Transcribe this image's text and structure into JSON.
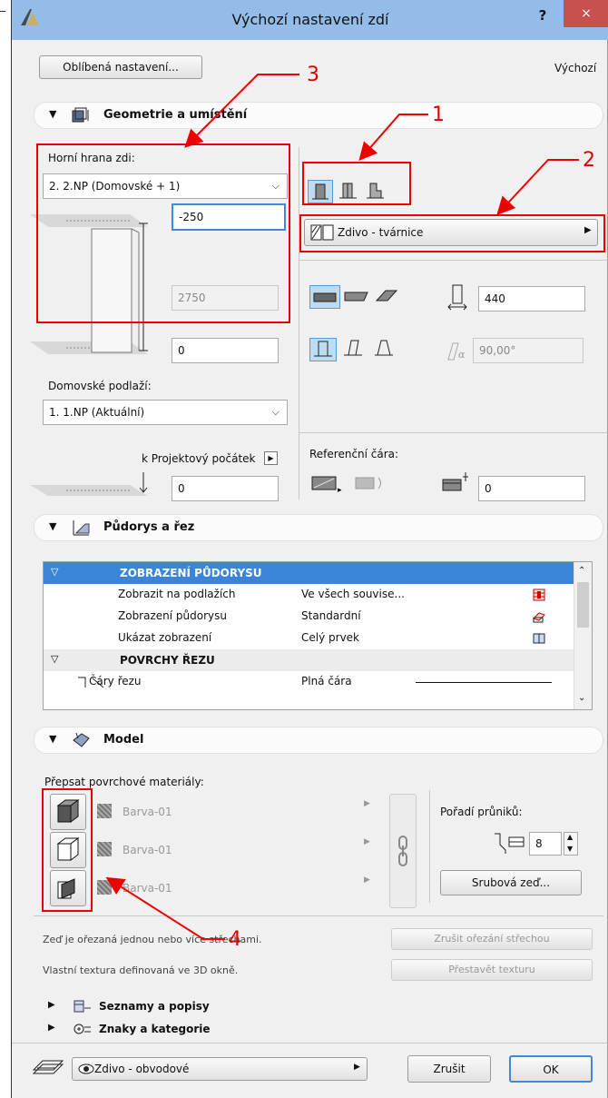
{
  "window": {
    "title": "Výchozí nastavení zdí",
    "help": "?",
    "close": "×"
  },
  "top": {
    "favorites_button": "Oblíbená nastavení...",
    "default_label": "Výchozí"
  },
  "sections": {
    "geometry": "Geometrie a umístění",
    "floorplan": "Půdorys a řez",
    "model": "Model",
    "lists": "Seznamy a popisy",
    "tags": "Znaky a kategorie"
  },
  "geometry": {
    "top_edge_label": "Horní hrana zdi:",
    "top_edge_value": "2. 2.NP (Domovské + 1)",
    "offset_value": "-250",
    "height_value": "2750",
    "bottom_offset": "0",
    "home_story_label": "Domovské podlaží:",
    "home_story_value": "1. 1.NP (Aktuální)",
    "project_origin_label": "k Projektový počátek",
    "project_origin_value": "0",
    "structure_value": "Zdivo - tvárnice",
    "thickness_value": "440",
    "angle_value": "90,00°",
    "ref_line_label": "Referenční čára:",
    "ref_offset_value": "0"
  },
  "floorplan": {
    "group1": "ZOBRAZENÍ PŮDORYSU",
    "rows": [
      {
        "name": "Zobrazit na podlažích",
        "value": "Ve všech souvise..."
      },
      {
        "name": "Zobrazení půdorysu",
        "value": "Standardní"
      },
      {
        "name": "Ukázat zobrazení",
        "value": "Celý prvek"
      }
    ],
    "group2": "POVRCHY ŘEZU",
    "cut_row": {
      "name": "Čáry řezu",
      "value": "Plná čára"
    }
  },
  "model": {
    "override_label": "Přepsat povrchové materiály:",
    "materials": [
      "Barva-01",
      "Barva-01",
      "Barva-01"
    ],
    "priority_label": "Pořadí průniků:",
    "priority_value": "8",
    "log_button": "Srubová zeď...",
    "trim_text": "Zeď je ořezaná jednou nebo více střechami.",
    "trim_button": "Zrušit ořezání střechou",
    "texture_text": "Vlastní textura definovaná ve 3D okně.",
    "texture_button": "Přestavět texturu"
  },
  "bottom": {
    "layer_value": "Zdivo - obvodové",
    "cancel": "Zrušit",
    "ok": "OK"
  },
  "annotations": {
    "n1": "1",
    "n2": "2",
    "n3": "3",
    "n4": "4"
  }
}
